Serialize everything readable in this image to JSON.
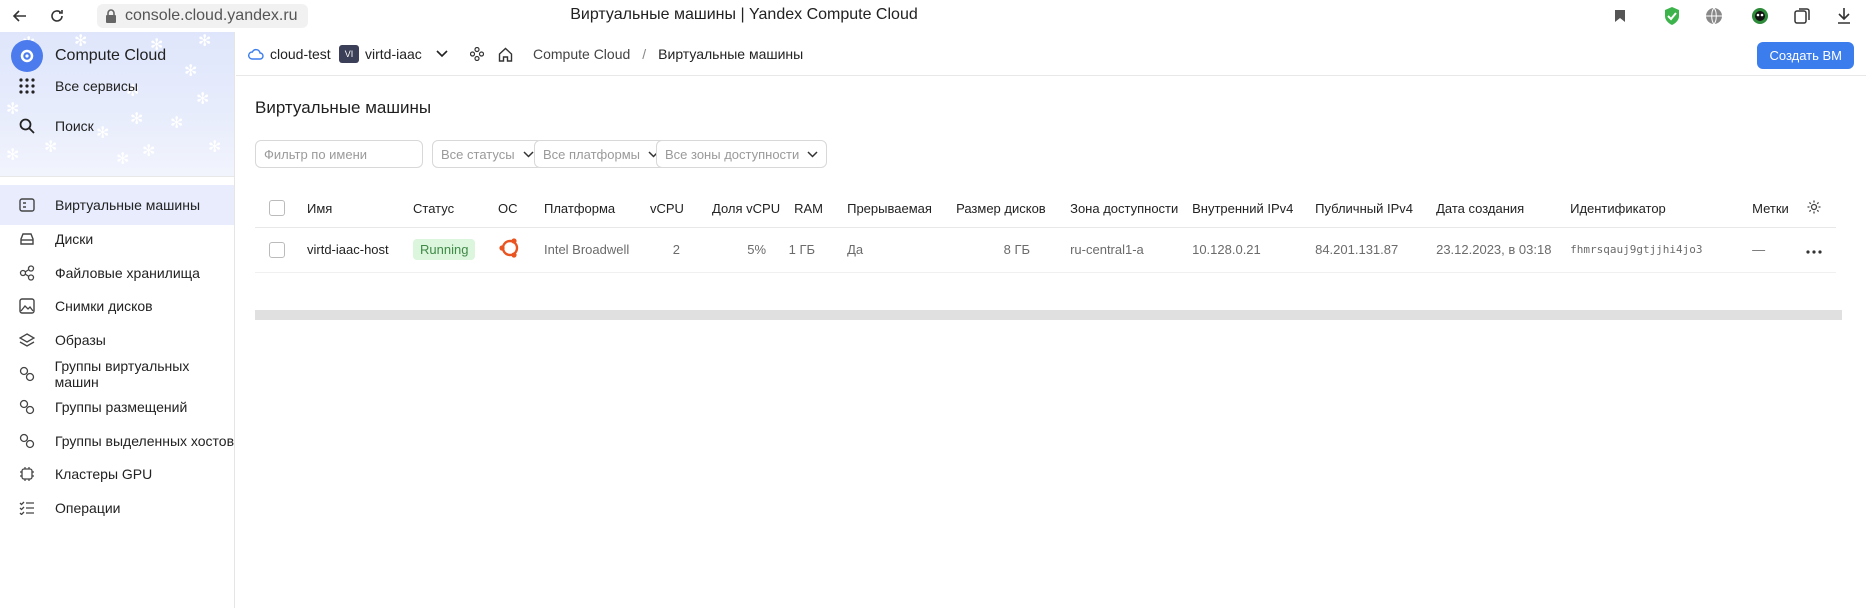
{
  "browser": {
    "url": "console.cloud.yandex.ru",
    "title": "Виртуальные машины | Yandex Compute Cloud"
  },
  "sidebar": {
    "brand": "Compute Cloud",
    "all_services": "Все сервисы",
    "search": "Поиск",
    "items": [
      {
        "label": "Виртуальные машины",
        "icon": "vm-icon",
        "active": true
      },
      {
        "label": "Диски",
        "icon": "disk-icon"
      },
      {
        "label": "Файловые хранилища",
        "icon": "share-icon"
      },
      {
        "label": "Снимки дисков",
        "icon": "image-icon"
      },
      {
        "label": "Образы",
        "icon": "layers-icon"
      },
      {
        "label": "Группы виртуальных машин",
        "icon": "groups-icon"
      },
      {
        "label": "Группы размещений",
        "icon": "groups-icon"
      },
      {
        "label": "Группы выделенных хостов",
        "icon": "groups-icon"
      },
      {
        "label": "Кластеры GPU",
        "icon": "chip-icon"
      },
      {
        "label": "Операции",
        "icon": "list-icon"
      }
    ]
  },
  "header": {
    "cloud": "cloud-test",
    "folder_avatar": "VI",
    "folder": "virtd-iaac",
    "breadcrumb_service": "Compute Cloud",
    "breadcrumb_sep": "/",
    "breadcrumb_page": "Виртуальные машины",
    "create_button": "Создать ВМ"
  },
  "main": {
    "title": "Виртуальные машины",
    "filters": {
      "name_placeholder": "Фильтр по имени",
      "status": "Все статусы",
      "platform": "Все платформы",
      "zone": "Все зоны доступности"
    },
    "columns": [
      "Имя",
      "Статус",
      "ОС",
      "Платформа",
      "vCPU",
      "Доля vCPU",
      "RAM",
      "Прерываемая",
      "Размер дисков",
      "Зона доступности",
      "Внутренний IPv4",
      "Публичный IPv4",
      "Дата создания",
      "Идентификатор",
      "Метки"
    ],
    "rows": [
      {
        "name": "virtd-iaac-host",
        "status": "Running",
        "os": "ubuntu",
        "platform": "Intel Broadwell",
        "vcpu": "2",
        "vcpu_share": "5%",
        "ram": "1 ГБ",
        "preemptible": "Да",
        "disk_size": "8 ГБ",
        "zone": "ru-central1-a",
        "internal_ip": "10.128.0.21",
        "public_ip": "84.201.131.87",
        "created": "23.12.2023, в 03:18",
        "id": "fhmrsqauj9gtjjhi4jo3",
        "labels": "—"
      }
    ]
  },
  "colors": {
    "accent": "#3b7ded",
    "running_bg": "#dcf5dd",
    "running_fg": "#3e8a46",
    "ubuntu": "#e95420"
  }
}
